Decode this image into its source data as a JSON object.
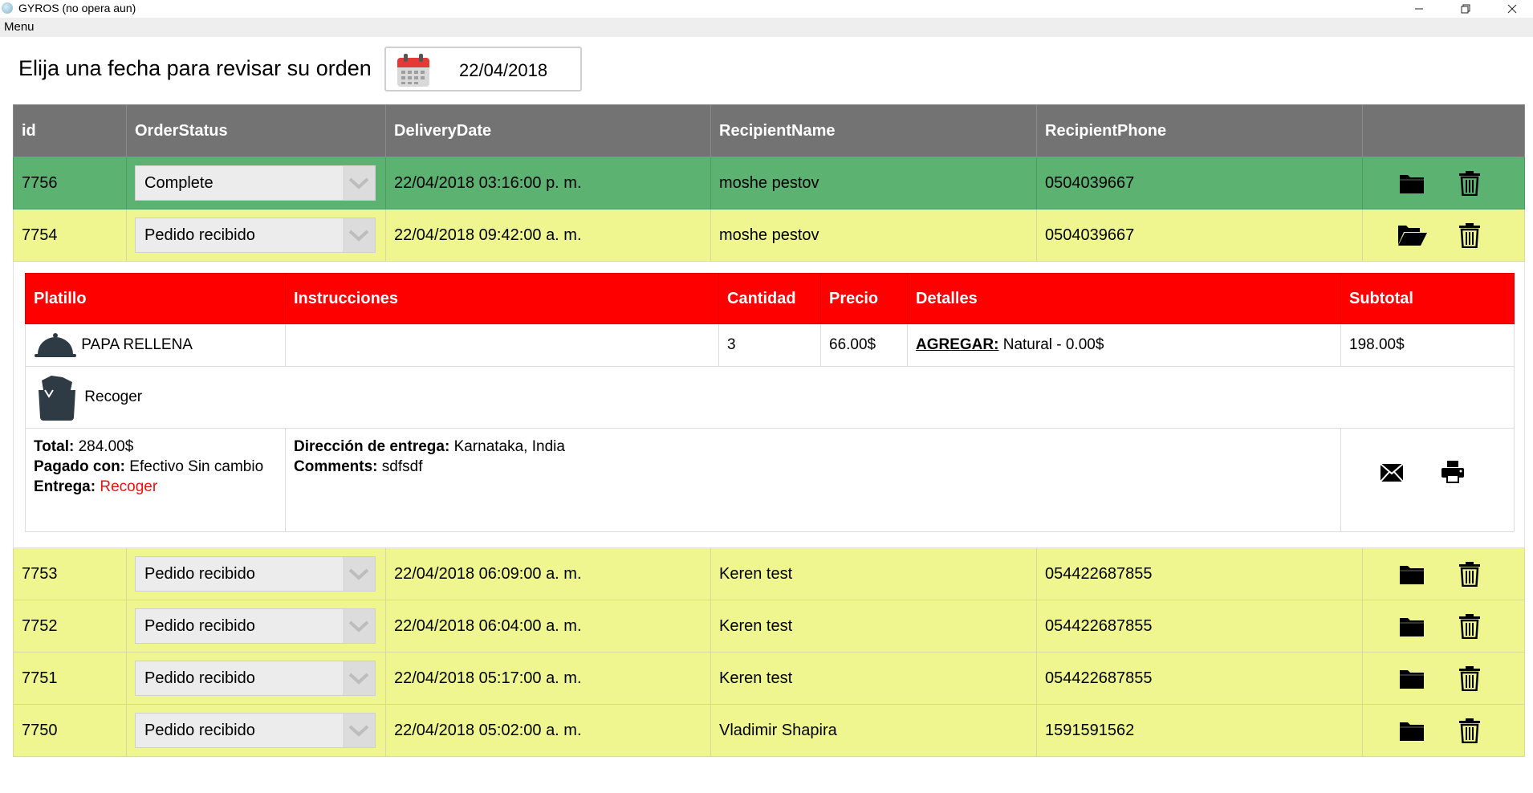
{
  "window": {
    "title": "GYROS (no opera aun)"
  },
  "menu": {
    "label": "Menu"
  },
  "date_prompt": {
    "label": "Elija una fecha para revisar su orden",
    "value": "22/04/2018"
  },
  "table": {
    "headers": [
      "id",
      "OrderStatus",
      "DeliveryDate",
      "RecipientName",
      "RecipientPhone",
      ""
    ],
    "rows": [
      {
        "id": "7756",
        "status": "Complete",
        "date": "22/04/2018 03:16:00 p. m.",
        "name": "moshe pestov",
        "phone": "0504039667"
      },
      {
        "id": "7754",
        "status": "Pedido recibido",
        "date": "22/04/2018 09:42:00 a. m.",
        "name": "moshe pestov",
        "phone": "0504039667"
      },
      {
        "id": "7753",
        "status": "Pedido recibido",
        "date": "22/04/2018 06:09:00 a. m.",
        "name": "Keren test",
        "phone": "054422687855"
      },
      {
        "id": "7752",
        "status": "Pedido recibido",
        "date": "22/04/2018 06:04:00 a. m.",
        "name": "Keren test",
        "phone": "054422687855"
      },
      {
        "id": "7751",
        "status": "Pedido recibido",
        "date": "22/04/2018 05:17:00 a. m.",
        "name": "Keren test",
        "phone": "054422687855"
      },
      {
        "id": "7750",
        "status": "Pedido recibido",
        "date": "22/04/2018 05:02:00 a. m.",
        "name": "Vladimir Shapira",
        "phone": "1591591562"
      }
    ]
  },
  "order_detail": {
    "headers": [
      "Platillo",
      "Instrucciones",
      "Cantidad",
      "Precio",
      "Detalles",
      "Subtotal"
    ],
    "item": {
      "name": "PAPA RELLENA",
      "instructions": "",
      "quantity": "3",
      "price": "66.00$",
      "details_label": "AGREGAR:",
      "details_value": "Natural - 0.00$",
      "subtotal": "198.00$"
    },
    "pickup_label": "Recoger",
    "total_label": "Total:",
    "total_value": "284.00$",
    "paid_label": "Pagado con:",
    "paid_value": "Efectivo Sin cambio",
    "delivery_label": "Entrega:",
    "delivery_value": "Recoger",
    "address_label": "Dirección de entrega:",
    "address_value": "Karnataka, India",
    "comments_label": "Comments:",
    "comments_value": "sdfsdf"
  },
  "colors": {
    "header_gray": "#737373",
    "row_complete": "#5cb270",
    "row_received": "#f0f68f",
    "detail_header": "#ff0000"
  },
  "icons": [
    "calendar-icon",
    "folder-icon",
    "folder-open-icon",
    "trash-icon",
    "cloche-icon",
    "bag-icon",
    "envelope-icon",
    "printer-icon"
  ]
}
